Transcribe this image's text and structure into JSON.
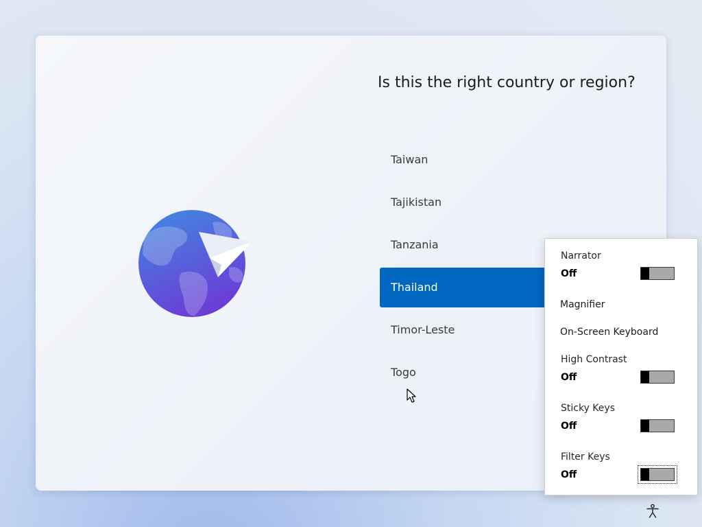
{
  "page": {
    "title": "Is this the right country or region?"
  },
  "countries": [
    {
      "label": "Taiwan",
      "selected": false
    },
    {
      "label": "Tajikistan",
      "selected": false
    },
    {
      "label": "Tanzania",
      "selected": false
    },
    {
      "label": "Thailand",
      "selected": true
    },
    {
      "label": "Timor-Leste",
      "selected": false
    },
    {
      "label": "Togo",
      "selected": false
    }
  ],
  "accessibility": {
    "narrator": {
      "label": "Narrator",
      "state": "Off",
      "on": false
    },
    "magnifier": {
      "label": "Magnifier"
    },
    "on_screen_keyboard": {
      "label": "On-Screen Keyboard"
    },
    "high_contrast": {
      "label": "High Contrast",
      "state": "Off",
      "on": false
    },
    "sticky_keys": {
      "label": "Sticky Keys",
      "state": "Off",
      "on": false
    },
    "filter_keys": {
      "label": "Filter Keys",
      "state": "Off",
      "on": false
    }
  },
  "icons": {
    "globe": "globe-icon",
    "paper_plane": "paper-plane-icon",
    "accessibility": "accessibility-icon",
    "cursor": "mouse-cursor"
  },
  "colors": {
    "selection": "#0067c0",
    "globe_top": "#3f8be0",
    "globe_bottom": "#6a3fd6"
  }
}
